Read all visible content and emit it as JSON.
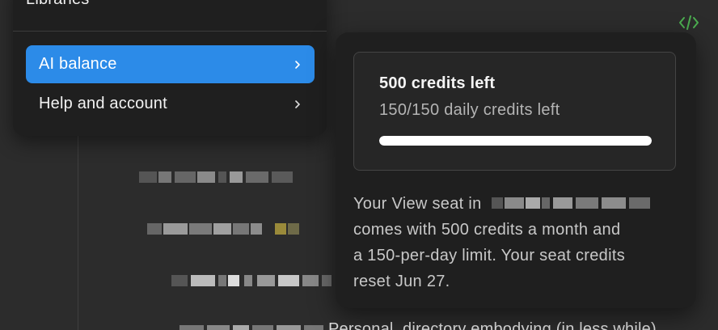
{
  "menu": {
    "items": [
      {
        "label": "Libraries"
      },
      {
        "label": "AI balance",
        "active": true
      },
      {
        "label": "Help and account"
      }
    ]
  },
  "toolbar": {
    "code_icon": "code-icon"
  },
  "ai_balance": {
    "credits_title": "500 credits left",
    "daily_credits": "150/150 daily credits left",
    "daily_progress_fraction": 1.0,
    "seat_text_line1": "Your View seat in",
    "seat_text_line2": "comes with 500 credits a month and",
    "seat_text_line3": "a 150-per-day limit. Your seat credits",
    "seat_text_line4": "reset Jun 27."
  },
  "background": {
    "partial_text": "Personal, directory embodying (in less while)"
  },
  "colors": {
    "accent": "#2c8be8",
    "code_icon": "#4caf50",
    "popover_bg": "#1f1f1f",
    "canvas_bg": "#2c2c2c"
  }
}
